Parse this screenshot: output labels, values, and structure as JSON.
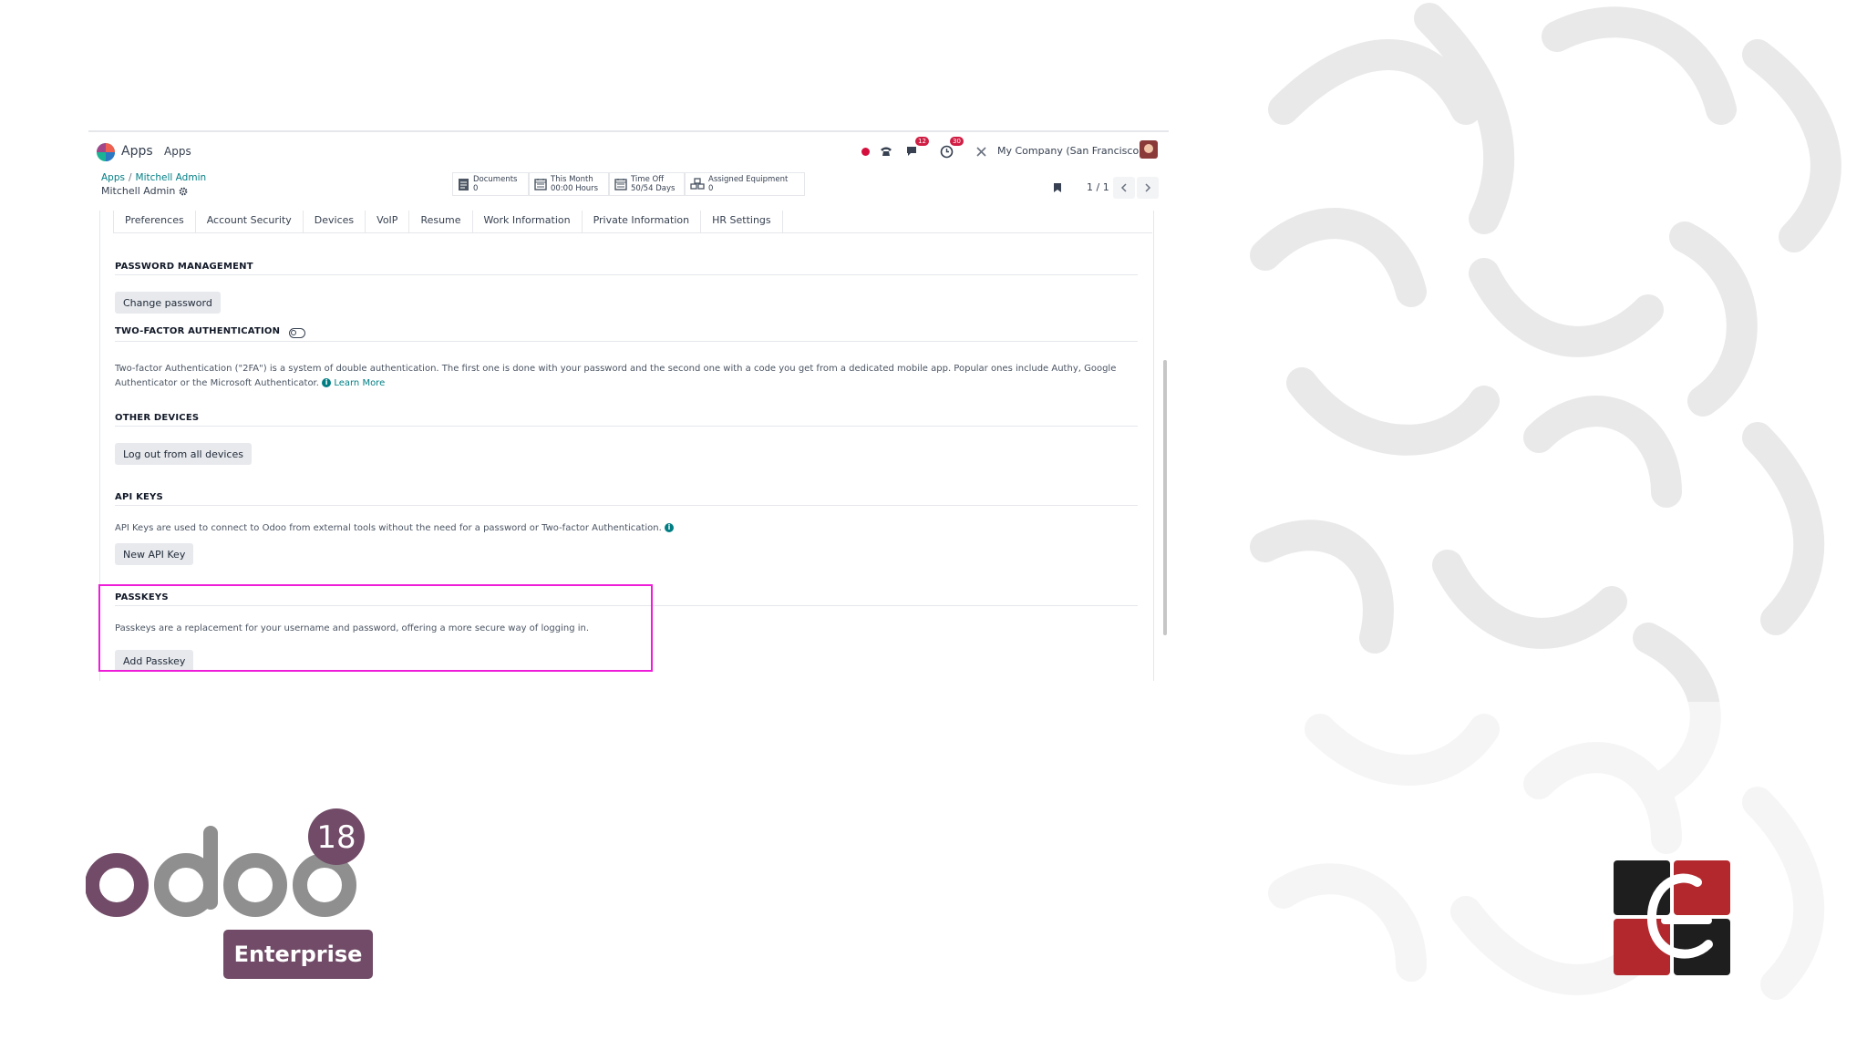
{
  "topbar": {
    "brand": "Apps",
    "menu": "Apps",
    "chat_badge": "12",
    "activity_badge": "30",
    "company": "My Company (San Francisco)"
  },
  "breadcrumb": {
    "root": "Apps",
    "separator": "/",
    "current": "Mitchell Admin"
  },
  "record": {
    "name": "Mitchell Admin"
  },
  "smart_buttons": [
    {
      "label": "Documents",
      "value": "0"
    },
    {
      "label": "This Month",
      "value": "00:00 Hours"
    },
    {
      "label": "Time Off",
      "value": "50/54 Days"
    },
    {
      "label": "Assigned Equipment",
      "value": "0"
    }
  ],
  "pager": {
    "value": "1 / 1"
  },
  "tabs": [
    "Preferences",
    "Account Security",
    "Devices",
    "VoIP",
    "Resume",
    "Work Information",
    "Private Information",
    "HR Settings"
  ],
  "sections": {
    "password": {
      "title": "PASSWORD MANAGEMENT",
      "button": "Change password"
    },
    "twofa": {
      "title": "TWO-FACTOR AUTHENTICATION",
      "text": "Two-factor Authentication (\"2FA\") is a system of double authentication. The first one is done with your password and the second one with a code you get from a dedicated mobile app. Popular ones include Authy, Google",
      "text2": "Authenticator or the Microsoft Authenticator.",
      "link": "Learn More"
    },
    "devices": {
      "title": "OTHER DEVICES",
      "button": "Log out from all devices"
    },
    "apikeys": {
      "title": "API KEYS",
      "text": "API Keys are used to connect to Odoo from external tools without the need for a password or Two-factor Authentication.",
      "button": "New API Key"
    },
    "passkeys": {
      "title": "PASSKEYS",
      "text": "Passkeys are a replacement for your username and password, offering a more secure way of logging in.",
      "button": "Add Passkey"
    }
  },
  "branding": {
    "version": "18",
    "edition": "Enterprise"
  },
  "colors": {
    "odoo_purple": "#714b67",
    "teal_link": "#017e84",
    "highlight": "#ee1ed8",
    "badge_red": "#d01e44"
  }
}
